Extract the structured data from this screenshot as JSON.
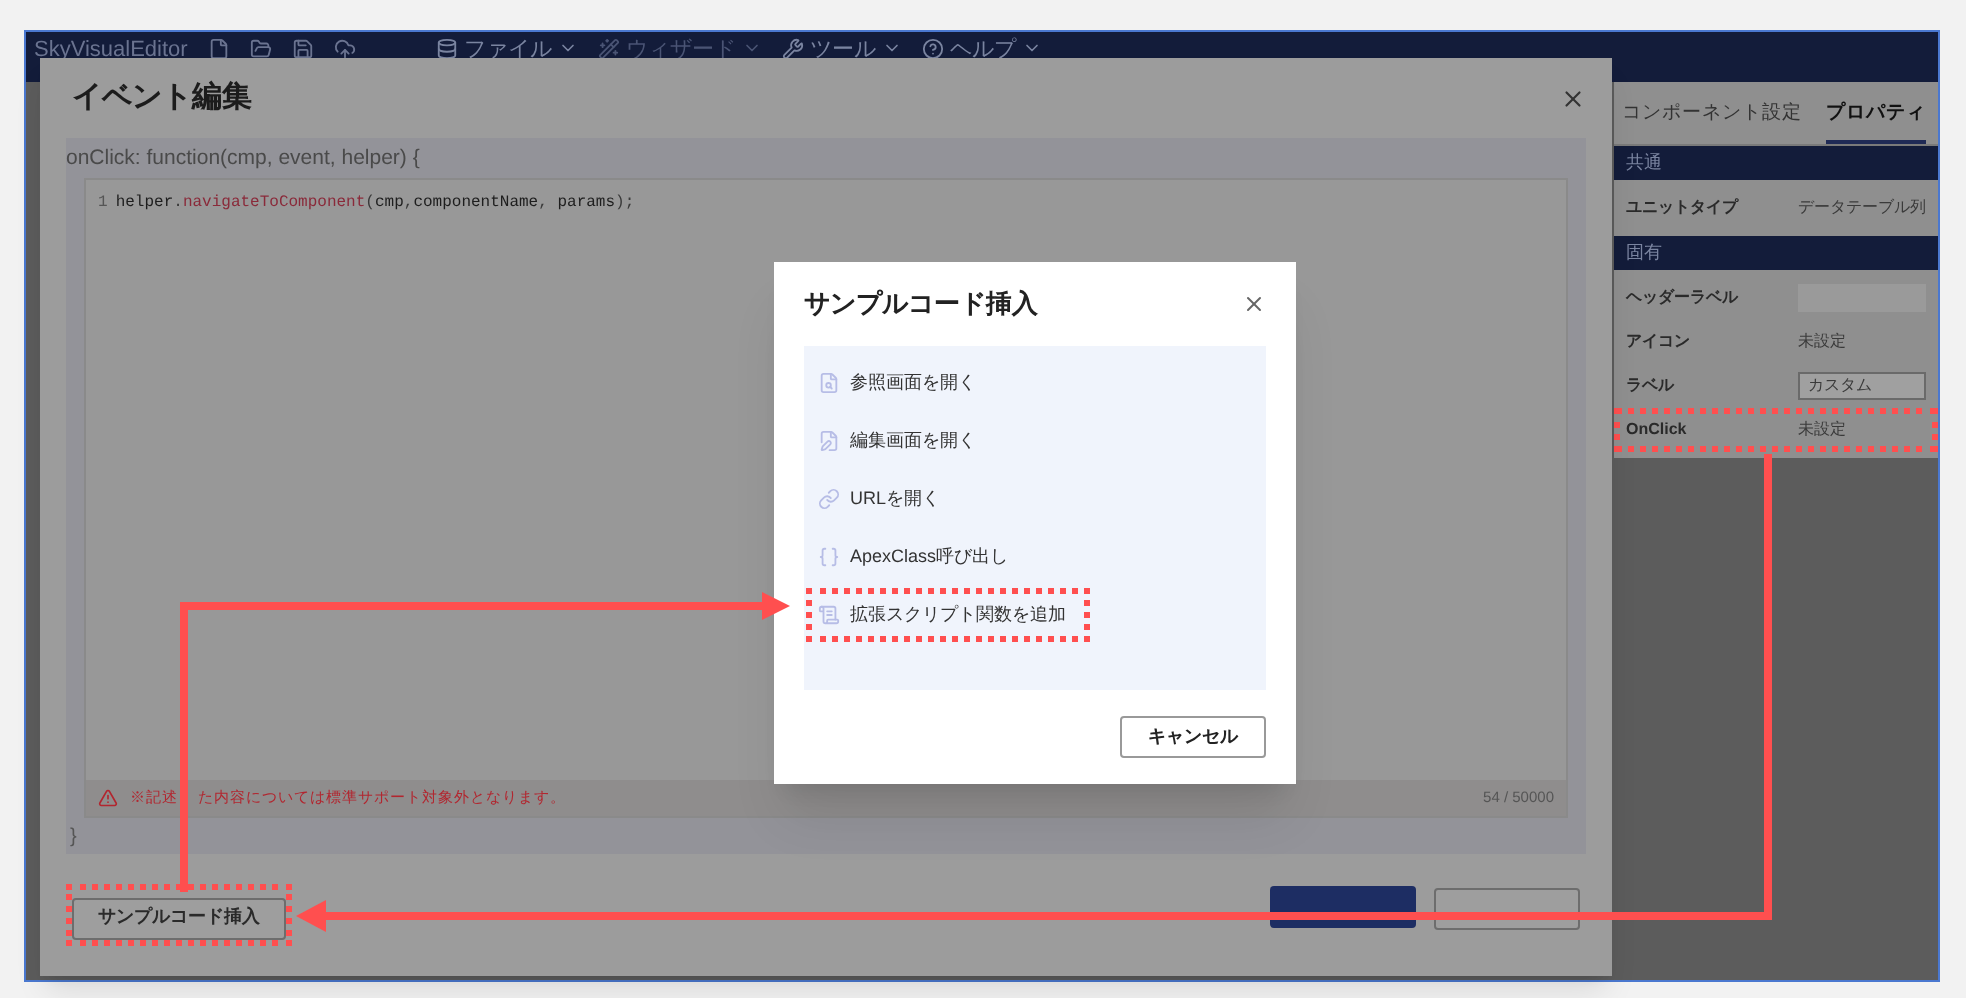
{
  "app": {
    "title": "SkyVisualEditor",
    "menu": [
      {
        "label": "ファイル",
        "disabled": false
      },
      {
        "label": "ウィザード",
        "disabled": true
      },
      {
        "label": "ツール",
        "disabled": false
      },
      {
        "label": "ヘルプ",
        "disabled": false
      }
    ]
  },
  "properties_panel": {
    "tabs": [
      {
        "label": "コンポーネント設定",
        "selected": false
      },
      {
        "label": "プロパティ",
        "selected": true
      }
    ],
    "sections": [
      {
        "title": "共通",
        "rows": [
          {
            "kind": "text",
            "label": "ユニットタイプ",
            "value": "データテーブル列",
            "highlighted": false
          }
        ]
      },
      {
        "title": "固有",
        "rows": [
          {
            "kind": "input",
            "label": "ヘッダーラベル",
            "highlighted": false
          },
          {
            "kind": "text",
            "label": "アイコン",
            "value": "未設定",
            "highlighted": false
          },
          {
            "kind": "select",
            "label": "ラベル",
            "value": "カスタム",
            "highlighted": false
          },
          {
            "kind": "text",
            "label": "OnClick",
            "value": "未設定",
            "highlighted": true
          }
        ]
      }
    ]
  },
  "event_dialog": {
    "title": "イベント編集",
    "signature": "onClick: function(cmp, event, helper) {",
    "code_lines": [
      {
        "number": "1",
        "tokens": [
          {
            "text": "helper",
            "kind": "plain"
          },
          {
            "text": ".",
            "kind": "punct"
          },
          {
            "text": "navigateToComponent",
            "kind": "method"
          },
          {
            "text": "(",
            "kind": "punct"
          },
          {
            "text": "cmp",
            "kind": "plain"
          },
          {
            "text": ",",
            "kind": "punct"
          },
          {
            "text": "componentName",
            "kind": "plain"
          },
          {
            "text": ", ",
            "kind": "punct"
          },
          {
            "text": "params",
            "kind": "plain"
          },
          {
            "text": ");",
            "kind": "punct"
          }
        ]
      }
    ],
    "warning_parts": [
      "※記述",
      "た内容については標準サポート対象外となります。"
    ],
    "counter": "54 / 50000",
    "closing_brace": "}",
    "buttons": [
      {
        "label": "サンプルコード挿入",
        "kind": "secondary",
        "highlighted": true
      },
      {
        "kind": "primary",
        "highlighted": false
      },
      {
        "kind": "secondary",
        "highlighted": false
      }
    ]
  },
  "sample_dialog": {
    "title": "サンプルコード挿入",
    "items": [
      {
        "label": "参照画面を開く",
        "highlighted": false
      },
      {
        "label": "編集画面を開く",
        "highlighted": false
      },
      {
        "label": "URLを開く",
        "highlighted": false
      },
      {
        "label": "ApexClass呼び出し",
        "highlighted": false
      },
      {
        "label": "拡張スクリプト関数を追加",
        "highlighted": true
      }
    ],
    "cancel": "キャンセル"
  }
}
